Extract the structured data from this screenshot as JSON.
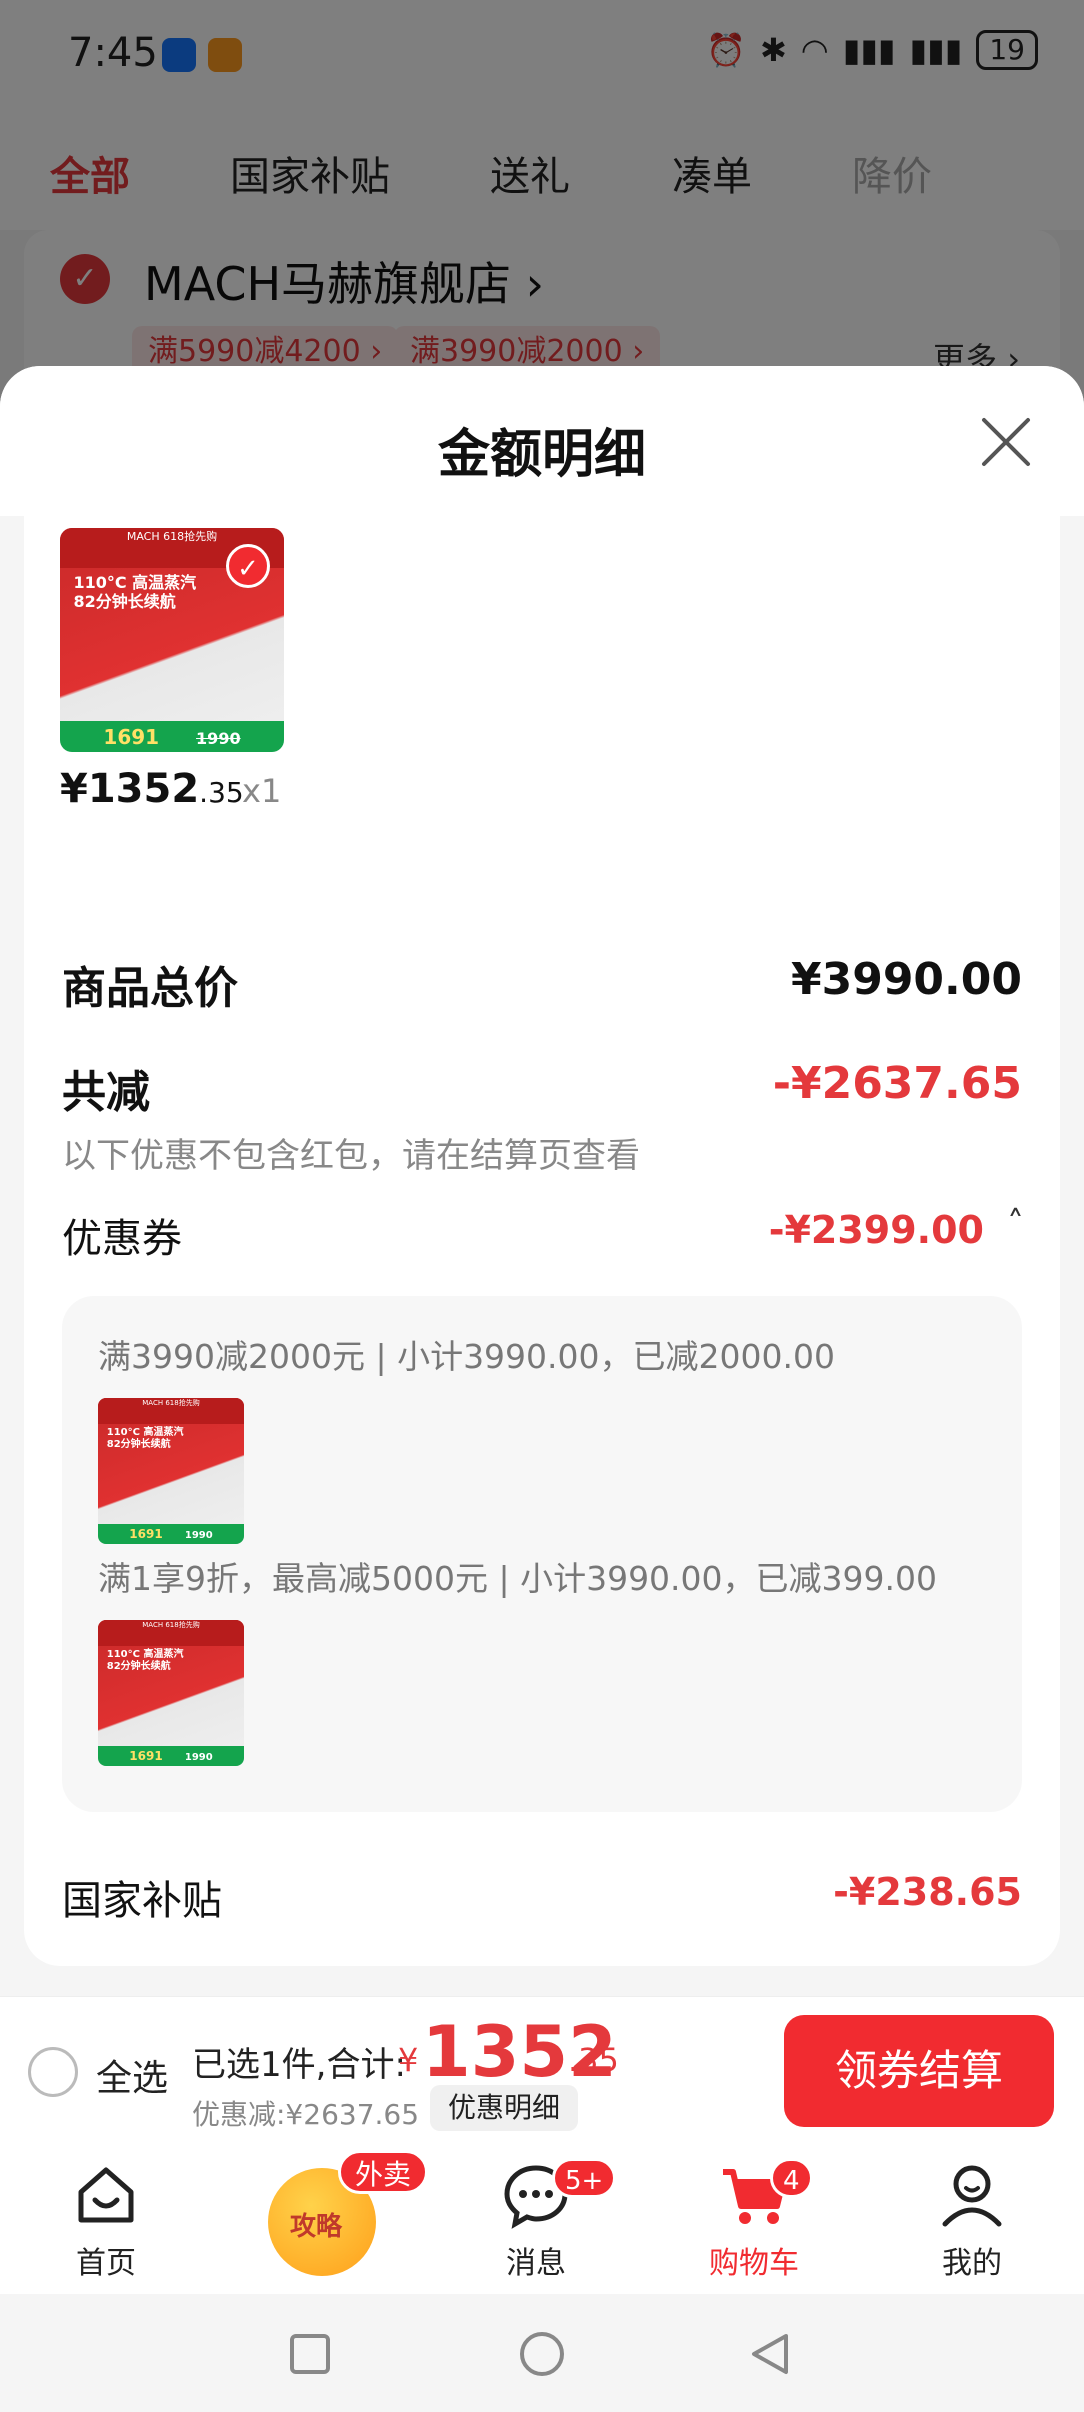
{
  "status_bar": {
    "time": "7:45",
    "battery": "19"
  },
  "tabs": [
    "全部",
    "国家补贴",
    "送礼",
    "凑单",
    "降价"
  ],
  "store": {
    "name": "MACH马赫旗舰店 ›",
    "chips": [
      "满5990减4200 ›",
      "满3990减2000 ›"
    ],
    "more": "更多 ›"
  },
  "sheet": {
    "title": "金额明细",
    "product": {
      "thumb": {
        "brand": "MACH  618抢先购",
        "headline1": "110°C 高温蒸汽",
        "headline2": "82分钟长续航",
        "price": "1691",
        "orig": "1990"
      },
      "price_int": "¥1352",
      "price_dec": ".35",
      "qty": "x1"
    },
    "summary": {
      "total_label": "商品总价",
      "total_value": "¥3990.00",
      "reduce_label": "共减",
      "reduce_value": "-¥2637.65",
      "note": "以下优惠不包含红包，请在结算页查看",
      "coupon_label": "优惠券",
      "coupon_value": "-¥2399.00",
      "coupon_lines": [
        "满3990减2000元 | 小计3990.00，已减2000.00",
        "满1享9折，最高减5000元 | 小计3990.00，已减399.00"
      ],
      "subsidy_label": "国家补贴",
      "subsidy_value": "-¥238.65"
    }
  },
  "checkout": {
    "select_all": "全选",
    "selected_text": "已选1件,合计:",
    "currency": "¥",
    "total_int": "1352",
    "total_dec": ".35",
    "discount": "优惠减:¥2637.65",
    "detail_btn": "优惠明细",
    "checkout_btn": "领券结算"
  },
  "tabbar": {
    "items": [
      {
        "label": "首页",
        "badge": ""
      },
      {
        "label": "攻略",
        "badge": "外卖"
      },
      {
        "label": "消息",
        "badge": "5+"
      },
      {
        "label": "购物车",
        "badge": "4"
      },
      {
        "label": "我的",
        "badge": ""
      }
    ]
  },
  "colors": {
    "accent": "#e4393c",
    "button": "#f12b30"
  }
}
